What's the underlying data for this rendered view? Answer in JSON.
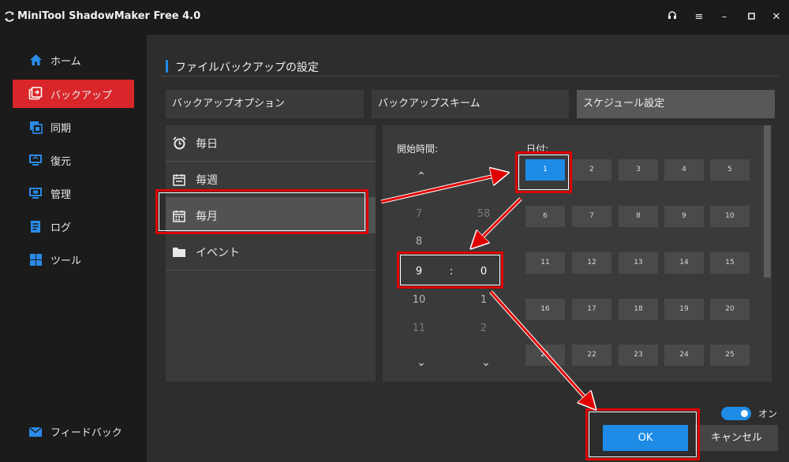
{
  "window": {
    "title": "MiniTool ShadowMaker Free 4.0",
    "controls": [
      "headset-icon",
      "menu-icon",
      "minimize-icon",
      "maximize-icon",
      "close-icon"
    ]
  },
  "sidebar": {
    "items": [
      {
        "label": "ホーム",
        "icon": "home-icon"
      },
      {
        "label": "バックアップ",
        "icon": "backup-icon",
        "active": true
      },
      {
        "label": "同期",
        "icon": "sync-icon"
      },
      {
        "label": "復元",
        "icon": "restore-icon"
      },
      {
        "label": "管理",
        "icon": "manage-icon"
      },
      {
        "label": "ログ",
        "icon": "log-icon"
      },
      {
        "label": "ツール",
        "icon": "tools-icon"
      }
    ],
    "feedback": "フィードバック"
  },
  "main": {
    "section_title": "ファイルバックアップの設定",
    "tabs": [
      "バックアップオプション",
      "バックアップスキーム",
      "スケジュール設定"
    ],
    "selected_tab": "スケジュール設定",
    "frequencies": [
      {
        "label": "毎日",
        "icon": "clock-icon"
      },
      {
        "label": "毎週",
        "icon": "calendar-week-icon"
      },
      {
        "label": "毎月",
        "icon": "calendar-month-icon",
        "active": true
      },
      {
        "label": "イベント",
        "icon": "folder-icon"
      }
    ],
    "schedule": {
      "start_time_label": "開始時間:",
      "date_label": "日付:",
      "hours": [
        "7",
        "8",
        "9",
        "10",
        "11"
      ],
      "minutes": [
        "58",
        "",
        "0",
        "1",
        "2"
      ],
      "selected_hour": "9",
      "selected_minute": "0",
      "separator": ":",
      "days": [
        "1",
        "2",
        "3",
        "4",
        "5",
        "6",
        "7",
        "8",
        "9",
        "10",
        "11",
        "12",
        "13",
        "14",
        "15",
        "16",
        "17",
        "18",
        "19",
        "20",
        "21",
        "22",
        "23",
        "24",
        "25"
      ],
      "selected_day": "1"
    },
    "toggle": {
      "label": "オン",
      "on": true
    },
    "ok_label": "OK",
    "cancel_label": "キャンセル"
  },
  "colors": {
    "accent": "#1e8be6",
    "active_nav": "#d9262a",
    "annotation_red": "#e00000"
  }
}
